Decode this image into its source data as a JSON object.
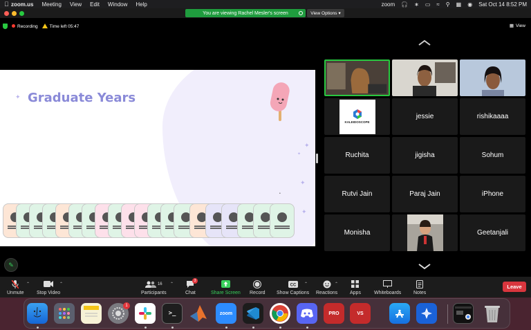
{
  "menubar": {
    "app_name": "zoom.us",
    "menus": [
      "Meeting",
      "View",
      "Edit",
      "Window",
      "Help"
    ],
    "zoom_label": "zoom",
    "datetime": "Sat Oct 14  8:52 PM"
  },
  "banner": {
    "text": "You are viewing Rachel Mesler's screen"
  },
  "view_options": {
    "label": "View Options"
  },
  "status": {
    "recording_label": "Recording",
    "time_left_label": "Time left",
    "time_left_value": "05:47",
    "view_label": "View"
  },
  "slide": {
    "title": "Graduate Years"
  },
  "participants_grid": {
    "tiles": [
      {
        "name": "",
        "kind": "video",
        "active": true
      },
      {
        "name": "",
        "kind": "video"
      },
      {
        "name": "",
        "kind": "video"
      },
      {
        "name": "",
        "kind": "logo",
        "logo_text": "KALEIDOSCOPE"
      },
      {
        "name": "jessie"
      },
      {
        "name": "rishikaaaa"
      },
      {
        "name": "Ruchita"
      },
      {
        "name": "jigisha"
      },
      {
        "name": "Sohum"
      },
      {
        "name": "Rutvi Jain"
      },
      {
        "name": "Paraj Jain"
      },
      {
        "name": "iPhone"
      },
      {
        "name": "Monisha"
      },
      {
        "name": "",
        "kind": "photo"
      },
      {
        "name": "Geetanjali"
      }
    ]
  },
  "toolbar": {
    "unmute": "Unmute",
    "stop_video": "Stop Video",
    "participants": "Participants",
    "participants_count": "16",
    "chat": "Chat",
    "chat_badge": "3",
    "share_screen": "Share Screen",
    "record": "Record",
    "show_captions": "Show Captions",
    "reactions": "Reactions",
    "apps": "Apps",
    "whiteboards": "Whiteboards",
    "notes": "Notes",
    "leave": "Leave"
  },
  "dock": {
    "settings_badge": "1",
    "zoom_label": "zoom",
    "pro_label": "PRO",
    "vs_label": "VS"
  },
  "colors": {
    "green": "#28c840",
    "leave_red": "#d9363e",
    "slide_title": "#8a8ad8"
  }
}
